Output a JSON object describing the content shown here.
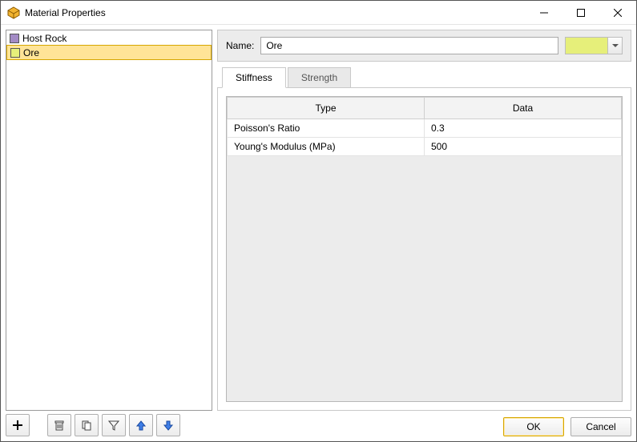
{
  "window": {
    "title": "Material Properties"
  },
  "sidebar": {
    "items": [
      {
        "label": "Host Rock",
        "swatch": "#a38bc5",
        "selected": false
      },
      {
        "label": "Ore",
        "swatch": "#e6ef7a",
        "selected": true
      }
    ]
  },
  "toolbar": {
    "add": {
      "icon": "plus-icon"
    },
    "delete": {
      "icon": "trash-icon"
    },
    "copy": {
      "icon": "copy-icon"
    },
    "filter": {
      "icon": "filter-icon"
    },
    "up": {
      "icon": "arrow-up-icon"
    },
    "down": {
      "icon": "arrow-down-icon"
    }
  },
  "form": {
    "name_label": "Name:",
    "name_value": "Ore",
    "color": "#e6ef7a"
  },
  "tabs": [
    {
      "label": "Stiffness",
      "active": true
    },
    {
      "label": "Strength",
      "active": false
    }
  ],
  "grid": {
    "headers": {
      "type": "Type",
      "data": "Data"
    },
    "rows": [
      {
        "type": "Poisson's Ratio",
        "data": "0.3"
      },
      {
        "type": "Young's Modulus (MPa)",
        "data": "500"
      }
    ]
  },
  "buttons": {
    "ok": "OK",
    "cancel": "Cancel"
  }
}
